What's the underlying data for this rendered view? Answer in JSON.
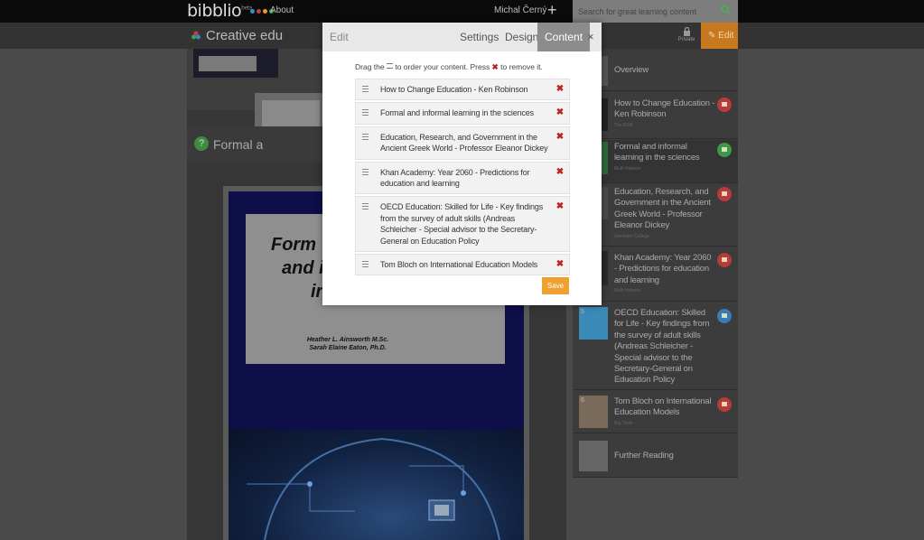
{
  "nav": {
    "logo": "bibblio",
    "logo_sup": "beta",
    "about": "About",
    "user": "Michal Černý",
    "search_placeholder": "Search for great learning content"
  },
  "subheader": {
    "collection_title": "Creative edu",
    "private_label": "Private",
    "edit_label": "Edit"
  },
  "page": {
    "section_title": "Formal a",
    "book": {
      "title_lines": [
        "Form",
        "and i",
        "in"
      ],
      "authors": [
        "Heather L. Ainsworth M.Sc.",
        "Sarah Elaine Eaton, Ph.D."
      ]
    }
  },
  "sidebar": {
    "items": [
      {
        "label": "Overview",
        "source": "",
        "num": ""
      },
      {
        "label": "How to Change Education - Ken Robinson",
        "source": "The RSA",
        "num": ""
      },
      {
        "label": "Formal and informal learning in the sciences",
        "source": "Multi Hebrew",
        "num": ""
      },
      {
        "label": "Education, Research, and Government in the Ancient Greek World - Professor Eleanor Dickey",
        "source": "Gresham College",
        "num": ""
      },
      {
        "label": "Khan Academy: Year 2060 - Predictions for education and learning",
        "source": "Multi Hebrew",
        "num": ""
      },
      {
        "label": "OECD Education: Skilled for Life - Key findings from the survey of adult skills (Andreas Schleicher - Special advisor to the Secretary-General on Education Policy",
        "source": "Best of Slideshare",
        "num": "5"
      },
      {
        "label": "Tom Bloch on International Education Models",
        "source": "Big Think",
        "num": "6"
      },
      {
        "label": "Further Reading",
        "source": "",
        "num": ""
      }
    ]
  },
  "modal": {
    "edit_label": "Edit",
    "tabs": [
      "Settings",
      "Design",
      "Content"
    ],
    "active_tab": "Content",
    "close": "×",
    "hint_before": "Drag the",
    "hint_middle": "to order your content. Press",
    "hint_after": "to remove it.",
    "remove_glyph": "✖",
    "items": [
      "How to Change Education - Ken Robinson",
      "Formal and informal learning in the sciences",
      "Education, Research, and Government in the Ancient Greek World - Professor Eleanor Dickey",
      "Khan Academy: Year 2060 - Predictions for education and learning",
      "OECD Education: Skilled for Life - Key findings from the survey of adult skills (Andreas Schleicher - Special advisor to the Secretary-General on Education Policy",
      "Tom Bloch on International Education Models"
    ],
    "save_label": "Save"
  },
  "colors": {
    "accent_orange": "#f0a030",
    "edit_orange": "#c8781e",
    "remove_red": "#c02020",
    "badge_red": "#b83a3a",
    "badge_green": "#3a9a4a",
    "badge_blue": "#3a7ab8"
  }
}
